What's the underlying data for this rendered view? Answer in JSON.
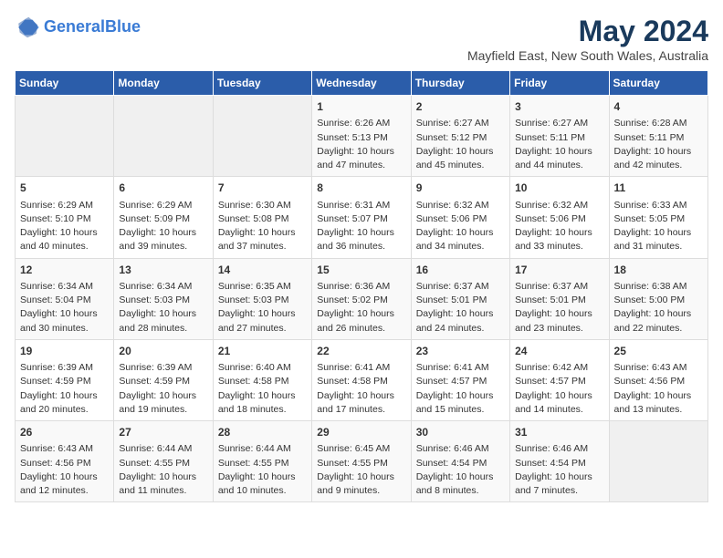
{
  "header": {
    "logo_line1": "General",
    "logo_line2": "Blue",
    "title": "May 2024",
    "subtitle": "Mayfield East, New South Wales, Australia"
  },
  "days_of_week": [
    "Sunday",
    "Monday",
    "Tuesday",
    "Wednesday",
    "Thursday",
    "Friday",
    "Saturday"
  ],
  "weeks": [
    [
      {
        "day": "",
        "content": ""
      },
      {
        "day": "",
        "content": ""
      },
      {
        "day": "",
        "content": ""
      },
      {
        "day": "1",
        "content": "Sunrise: 6:26 AM\nSunset: 5:13 PM\nDaylight: 10 hours\nand 47 minutes."
      },
      {
        "day": "2",
        "content": "Sunrise: 6:27 AM\nSunset: 5:12 PM\nDaylight: 10 hours\nand 45 minutes."
      },
      {
        "day": "3",
        "content": "Sunrise: 6:27 AM\nSunset: 5:11 PM\nDaylight: 10 hours\nand 44 minutes."
      },
      {
        "day": "4",
        "content": "Sunrise: 6:28 AM\nSunset: 5:11 PM\nDaylight: 10 hours\nand 42 minutes."
      }
    ],
    [
      {
        "day": "5",
        "content": "Sunrise: 6:29 AM\nSunset: 5:10 PM\nDaylight: 10 hours\nand 40 minutes."
      },
      {
        "day": "6",
        "content": "Sunrise: 6:29 AM\nSunset: 5:09 PM\nDaylight: 10 hours\nand 39 minutes."
      },
      {
        "day": "7",
        "content": "Sunrise: 6:30 AM\nSunset: 5:08 PM\nDaylight: 10 hours\nand 37 minutes."
      },
      {
        "day": "8",
        "content": "Sunrise: 6:31 AM\nSunset: 5:07 PM\nDaylight: 10 hours\nand 36 minutes."
      },
      {
        "day": "9",
        "content": "Sunrise: 6:32 AM\nSunset: 5:06 PM\nDaylight: 10 hours\nand 34 minutes."
      },
      {
        "day": "10",
        "content": "Sunrise: 6:32 AM\nSunset: 5:06 PM\nDaylight: 10 hours\nand 33 minutes."
      },
      {
        "day": "11",
        "content": "Sunrise: 6:33 AM\nSunset: 5:05 PM\nDaylight: 10 hours\nand 31 minutes."
      }
    ],
    [
      {
        "day": "12",
        "content": "Sunrise: 6:34 AM\nSunset: 5:04 PM\nDaylight: 10 hours\nand 30 minutes."
      },
      {
        "day": "13",
        "content": "Sunrise: 6:34 AM\nSunset: 5:03 PM\nDaylight: 10 hours\nand 28 minutes."
      },
      {
        "day": "14",
        "content": "Sunrise: 6:35 AM\nSunset: 5:03 PM\nDaylight: 10 hours\nand 27 minutes."
      },
      {
        "day": "15",
        "content": "Sunrise: 6:36 AM\nSunset: 5:02 PM\nDaylight: 10 hours\nand 26 minutes."
      },
      {
        "day": "16",
        "content": "Sunrise: 6:37 AM\nSunset: 5:01 PM\nDaylight: 10 hours\nand 24 minutes."
      },
      {
        "day": "17",
        "content": "Sunrise: 6:37 AM\nSunset: 5:01 PM\nDaylight: 10 hours\nand 23 minutes."
      },
      {
        "day": "18",
        "content": "Sunrise: 6:38 AM\nSunset: 5:00 PM\nDaylight: 10 hours\nand 22 minutes."
      }
    ],
    [
      {
        "day": "19",
        "content": "Sunrise: 6:39 AM\nSunset: 4:59 PM\nDaylight: 10 hours\nand 20 minutes."
      },
      {
        "day": "20",
        "content": "Sunrise: 6:39 AM\nSunset: 4:59 PM\nDaylight: 10 hours\nand 19 minutes."
      },
      {
        "day": "21",
        "content": "Sunrise: 6:40 AM\nSunset: 4:58 PM\nDaylight: 10 hours\nand 18 minutes."
      },
      {
        "day": "22",
        "content": "Sunrise: 6:41 AM\nSunset: 4:58 PM\nDaylight: 10 hours\nand 17 minutes."
      },
      {
        "day": "23",
        "content": "Sunrise: 6:41 AM\nSunset: 4:57 PM\nDaylight: 10 hours\nand 15 minutes."
      },
      {
        "day": "24",
        "content": "Sunrise: 6:42 AM\nSunset: 4:57 PM\nDaylight: 10 hours\nand 14 minutes."
      },
      {
        "day": "25",
        "content": "Sunrise: 6:43 AM\nSunset: 4:56 PM\nDaylight: 10 hours\nand 13 minutes."
      }
    ],
    [
      {
        "day": "26",
        "content": "Sunrise: 6:43 AM\nSunset: 4:56 PM\nDaylight: 10 hours\nand 12 minutes."
      },
      {
        "day": "27",
        "content": "Sunrise: 6:44 AM\nSunset: 4:55 PM\nDaylight: 10 hours\nand 11 minutes."
      },
      {
        "day": "28",
        "content": "Sunrise: 6:44 AM\nSunset: 4:55 PM\nDaylight: 10 hours\nand 10 minutes."
      },
      {
        "day": "29",
        "content": "Sunrise: 6:45 AM\nSunset: 4:55 PM\nDaylight: 10 hours\nand 9 minutes."
      },
      {
        "day": "30",
        "content": "Sunrise: 6:46 AM\nSunset: 4:54 PM\nDaylight: 10 hours\nand 8 minutes."
      },
      {
        "day": "31",
        "content": "Sunrise: 6:46 AM\nSunset: 4:54 PM\nDaylight: 10 hours\nand 7 minutes."
      },
      {
        "day": "",
        "content": ""
      }
    ]
  ]
}
